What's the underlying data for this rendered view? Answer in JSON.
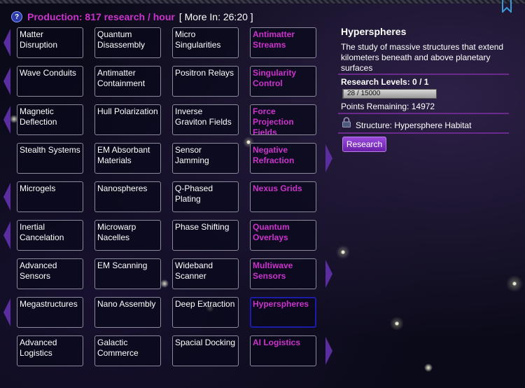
{
  "header": {
    "help_icon": "?",
    "production": "Production: 817 research / hour",
    "timer": "[ More In: 26:20 ]"
  },
  "icons": {
    "help": "help-icon",
    "bookmark": "bookmark-icon",
    "lock": "lock-icon",
    "arrow": "row-arrow"
  },
  "colors": {
    "special_text": "#cc33cc",
    "selected_border": "#1c1ca8",
    "accent": "#8a3ad0"
  },
  "grid": {
    "rows": [
      {
        "left_arrow": true,
        "right_arrow": false,
        "tiles": [
          {
            "label": "Matter Disruption",
            "special": false
          },
          {
            "label": "Quantum Disassembly",
            "special": false
          },
          {
            "label": "Micro Singularities",
            "special": false
          },
          {
            "label": "Antimatter Streams",
            "special": true
          }
        ]
      },
      {
        "left_arrow": true,
        "right_arrow": false,
        "tiles": [
          {
            "label": "Wave Conduits",
            "special": false
          },
          {
            "label": "Antimatter Containment",
            "special": false
          },
          {
            "label": "Positron Relays",
            "special": false
          },
          {
            "label": "Singularity Control",
            "special": true
          }
        ]
      },
      {
        "left_arrow": true,
        "right_arrow": false,
        "tiles": [
          {
            "label": "Magnetic Deflection",
            "special": false
          },
          {
            "label": "Hull Polarization",
            "special": false
          },
          {
            "label": "Inverse Graviton Fields",
            "special": false
          },
          {
            "label": "Force Projection Fields",
            "special": true
          }
        ]
      },
      {
        "left_arrow": false,
        "right_arrow": true,
        "tiles": [
          {
            "label": "Stealth Systems",
            "special": false
          },
          {
            "label": "EM Absorbant Materials",
            "special": false
          },
          {
            "label": "Sensor Jamming",
            "special": false
          },
          {
            "label": "Negative Refraction",
            "special": true
          }
        ]
      },
      {
        "left_arrow": true,
        "right_arrow": false,
        "tiles": [
          {
            "label": "Microgels",
            "special": false
          },
          {
            "label": "Nanospheres",
            "special": false
          },
          {
            "label": "Q-Phased Plating",
            "special": false
          },
          {
            "label": "Nexus Grids",
            "special": true
          }
        ]
      },
      {
        "left_arrow": true,
        "right_arrow": false,
        "tiles": [
          {
            "label": "Inertial Cancelation",
            "special": false
          },
          {
            "label": "Microwarp Nacelles",
            "special": false
          },
          {
            "label": "Phase Shifting",
            "special": false
          },
          {
            "label": "Quantum Overlays",
            "special": true
          }
        ]
      },
      {
        "left_arrow": false,
        "right_arrow": true,
        "tiles": [
          {
            "label": "Advanced Sensors",
            "special": false
          },
          {
            "label": "EM Scanning",
            "special": false
          },
          {
            "label": "Wideband Scanner",
            "special": false
          },
          {
            "label": "Multiwave Sensors",
            "special": true
          }
        ]
      },
      {
        "left_arrow": true,
        "right_arrow": false,
        "tiles": [
          {
            "label": "Megastructures",
            "special": false
          },
          {
            "label": "Nano Assembly",
            "special": false
          },
          {
            "label": "Deep Extraction",
            "special": false
          },
          {
            "label": "Hyperspheres",
            "special": true,
            "selected": true
          }
        ]
      },
      {
        "left_arrow": false,
        "right_arrow": true,
        "tiles": [
          {
            "label": "Advanced Logistics",
            "special": false
          },
          {
            "label": "Galactic Commerce",
            "special": false
          },
          {
            "label": "Spacial Docking",
            "special": false
          },
          {
            "label": "AI Logistics",
            "special": true
          }
        ]
      }
    ]
  },
  "panel": {
    "title": "Hyperspheres",
    "description": "The study of massive structures that extend kilometers beneath and above planetary surfaces",
    "levels": "Research Levels: 0 / 1",
    "progress": {
      "text": "28 / 15000",
      "fraction": 0.0019
    },
    "remaining": "Points Remaining: 14972",
    "structure": "Structure: Hypersphere Habitat",
    "button": "Research"
  }
}
